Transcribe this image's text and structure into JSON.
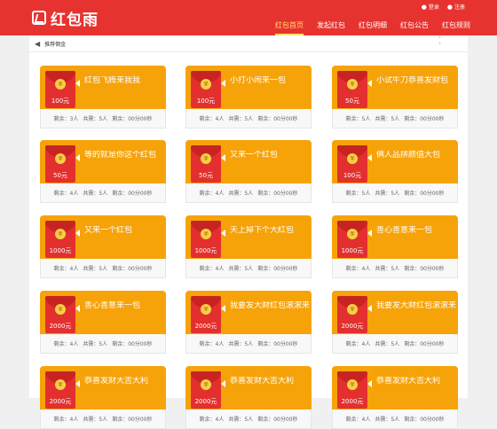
{
  "brand": {
    "name": "红包雨",
    "logo_icon": "red-envelope-logo-icon"
  },
  "topbar": {
    "login": "登录",
    "register": "注册"
  },
  "nav": [
    {
      "label": "红包首页",
      "active": true
    },
    {
      "label": "发起红包",
      "active": false
    },
    {
      "label": "红包明细",
      "active": false
    },
    {
      "label": "红包公告",
      "active": false
    },
    {
      "label": "红包规则",
      "active": false
    }
  ],
  "notice": {
    "text": "推荐佣金"
  },
  "cards": [
    {
      "title": "红包飞腾来我我",
      "amount": "100元",
      "remaining": "剩余：3人",
      "total": "共需：5人",
      "time": "剩余：00分00秒"
    },
    {
      "title": "小打小闹来一包",
      "amount": "100元",
      "remaining": "剩余：4人",
      "total": "共需：5人",
      "time": "剩余：00分00秒"
    },
    {
      "title": "小试牛刀恭喜发财包",
      "amount": "50元",
      "remaining": "剩余：5人",
      "total": "共需：5人",
      "time": "剩余：00分00秒"
    },
    {
      "title": "等的就是你这个红包",
      "amount": "50元",
      "remaining": "剩余：4人",
      "total": "共需：5人",
      "time": "剩余：00分00秒"
    },
    {
      "title": "又来一个红包",
      "amount": "50元",
      "remaining": "剩余：4人",
      "total": "共需：5人",
      "time": "剩余：00分00秒"
    },
    {
      "title": "俩人品拼颜值大包",
      "amount": "100元",
      "remaining": "剩余：5人",
      "total": "共需：5人",
      "time": "剩余：00分00秒"
    },
    {
      "title": "又来一个红包",
      "amount": "1000元",
      "remaining": "剩余：4人",
      "total": "共需：5人",
      "time": "剩余：00分00秒"
    },
    {
      "title": "天上掉下个大红包",
      "amount": "1000元",
      "remaining": "剩余：4人",
      "total": "共需：5人",
      "time": "剩余：00分00秒"
    },
    {
      "title": "善心善意来一包",
      "amount": "1000元",
      "remaining": "剩余：4人",
      "total": "共需：5人",
      "time": "剩余：00分00秒"
    },
    {
      "title": "善心善意来一包",
      "amount": "2000元",
      "remaining": "剩余：4人",
      "total": "共需：5人",
      "time": "剩余：00分00秒"
    },
    {
      "title": "我要发大财红包滚滚来",
      "amount": "2000元",
      "remaining": "剩余：4人",
      "total": "共需：5人",
      "time": "剩余：00分00秒"
    },
    {
      "title": "我要发大财红包滚滚来",
      "amount": "2000元",
      "remaining": "剩余：4人",
      "total": "共需：5人",
      "time": "剩余：00分00秒"
    },
    {
      "title": "恭喜发财大吉大利",
      "amount": "2000元",
      "remaining": "剩余：4人",
      "total": "共需：5人",
      "time": "剩余：00分00秒"
    },
    {
      "title": "恭喜发财大吉大利",
      "amount": "2000元",
      "remaining": "剩余：4人",
      "total": "共需：5人",
      "time": "剩余：00分00秒"
    },
    {
      "title": "恭喜发财大吉大利",
      "amount": "2000元",
      "remaining": "剩余：4人",
      "total": "共需：5人",
      "time": "剩余：00分00秒"
    }
  ],
  "colors": {
    "header": "#e73330",
    "card": "#f6a30a",
    "envelope": "#e3302f",
    "active_nav": "#ffe36b"
  }
}
